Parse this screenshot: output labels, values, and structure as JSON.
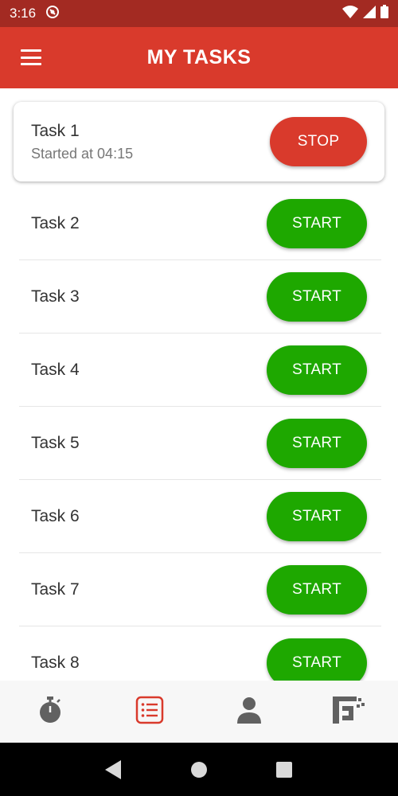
{
  "status_bar": {
    "time": "3:16"
  },
  "app_bar": {
    "title": "MY TASKS"
  },
  "active_task": {
    "name": "Task 1",
    "subtitle": "Started at 04:15",
    "action_label": "STOP"
  },
  "tasks": [
    {
      "name": "Task 2",
      "action_label": "START"
    },
    {
      "name": "Task 3",
      "action_label": "START"
    },
    {
      "name": "Task 4",
      "action_label": "START"
    },
    {
      "name": "Task 5",
      "action_label": "START"
    },
    {
      "name": "Task 6",
      "action_label": "START"
    },
    {
      "name": "Task 7",
      "action_label": "START"
    },
    {
      "name": "Task 8",
      "action_label": "START"
    }
  ],
  "bottom_nav": {
    "items": [
      {
        "icon": "stopwatch-icon"
      },
      {
        "icon": "task-list-icon",
        "active": true
      },
      {
        "icon": "person-icon"
      },
      {
        "icon": "logo-icon"
      }
    ]
  },
  "colors": {
    "primary": "#d93a2c",
    "primary_dark": "#a32a22",
    "start": "#1ea800",
    "nav_inactive": "#616161"
  }
}
